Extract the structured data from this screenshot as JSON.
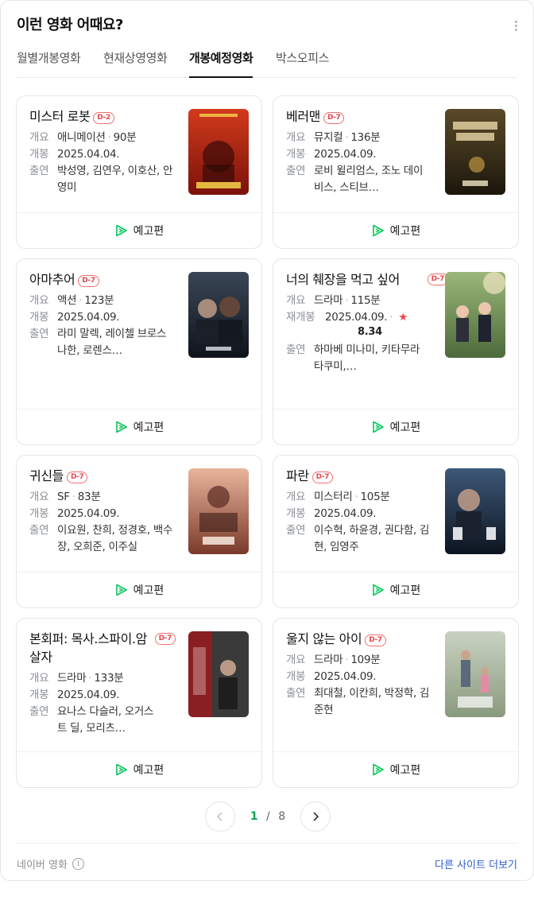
{
  "header": {
    "title": "이런 영화 어때요?"
  },
  "tabs": [
    "월별개봉영화",
    "현재상영영화",
    "개봉예정영화",
    "박스오피스"
  ],
  "active_tab": "개봉예정영화",
  "labels": {
    "overview": "개요",
    "release": "개봉",
    "rerelease": "재개봉",
    "cast": "출연",
    "trailer": "예고편"
  },
  "movies": [
    {
      "title": "미스터 로봇",
      "badge": "D-2",
      "genre": "애니메이션",
      "runtime": "90분",
      "release": "2025.04.04.",
      "cast": "박성영, 김연우, 이호산, 안영미",
      "poster_colors": [
        "#d13a1c",
        "#7a120a"
      ]
    },
    {
      "title": "베러맨",
      "badge": "D-7",
      "genre": "뮤지컬",
      "runtime": "136분",
      "release": "2025.04.09.",
      "cast": "로비 윌리엄스, 조노 데이비스, 스티브…",
      "poster_colors": [
        "#5a4a28",
        "#1c160c"
      ]
    },
    {
      "title": "아마추어",
      "badge": "D-7",
      "genre": "액션",
      "runtime": "123분",
      "release": "2025.04.09.",
      "cast": "라미 말렉, 레이첼 브로스나한, 로렌스…",
      "poster_colors": [
        "#3a4656",
        "#0f141c"
      ]
    },
    {
      "title": "너의 췌장을 먹고 싶어",
      "badge": "D-7",
      "genre": "드라마",
      "runtime": "115분",
      "release": "2025.04.09.",
      "rating": "8.34",
      "cast": "하마베 미나미, 키타무라 타쿠미,…",
      "poster_colors": [
        "#9bb77a",
        "#4c6a3a"
      ]
    },
    {
      "title": "귀신들",
      "badge": "D-7",
      "genre": "SF",
      "runtime": "83분",
      "release": "2025.04.09.",
      "cast": "이요원, 찬희, 정경호, 백수장, 오희준, 이주실",
      "poster_colors": [
        "#e9b59c",
        "#7a3a2a"
      ]
    },
    {
      "title": "파란",
      "badge": "D-7",
      "genre": "미스터리",
      "runtime": "105분",
      "release": "2025.04.09.",
      "cast": "이수혁, 하윤경, 권다함, 김현, 임영주",
      "poster_colors": [
        "#3d5878",
        "#0d1420"
      ]
    },
    {
      "title": "본회퍼: 목사.스파이.암살자",
      "badge": "D-7",
      "genre": "드라마",
      "runtime": "133분",
      "release": "2025.04.09.",
      "cast": "요나스 다슬러, 오거스트 딜, 모리츠…",
      "poster_colors": [
        "#8a1f22",
        "#2a2a2a"
      ]
    },
    {
      "title": "울지 않는 아이",
      "badge": "D-7",
      "genre": "드라마",
      "runtime": "109분",
      "release": "2025.04.09.",
      "cast": "최대철, 이칸희, 박정학, 김준현",
      "poster_colors": [
        "#c9d2c2",
        "#8a9a7e"
      ]
    }
  ],
  "pagination": {
    "current": "1",
    "separator": "/",
    "total": "8"
  },
  "footer": {
    "source": "네이버 영화",
    "more": "다른 사이트 더보기"
  },
  "colors": {
    "badge": "#e5484d",
    "trailer_icon": "#03c75a",
    "page_current": "#03a94d",
    "more_link": "#2c5ecf",
    "star": "#f04848"
  }
}
